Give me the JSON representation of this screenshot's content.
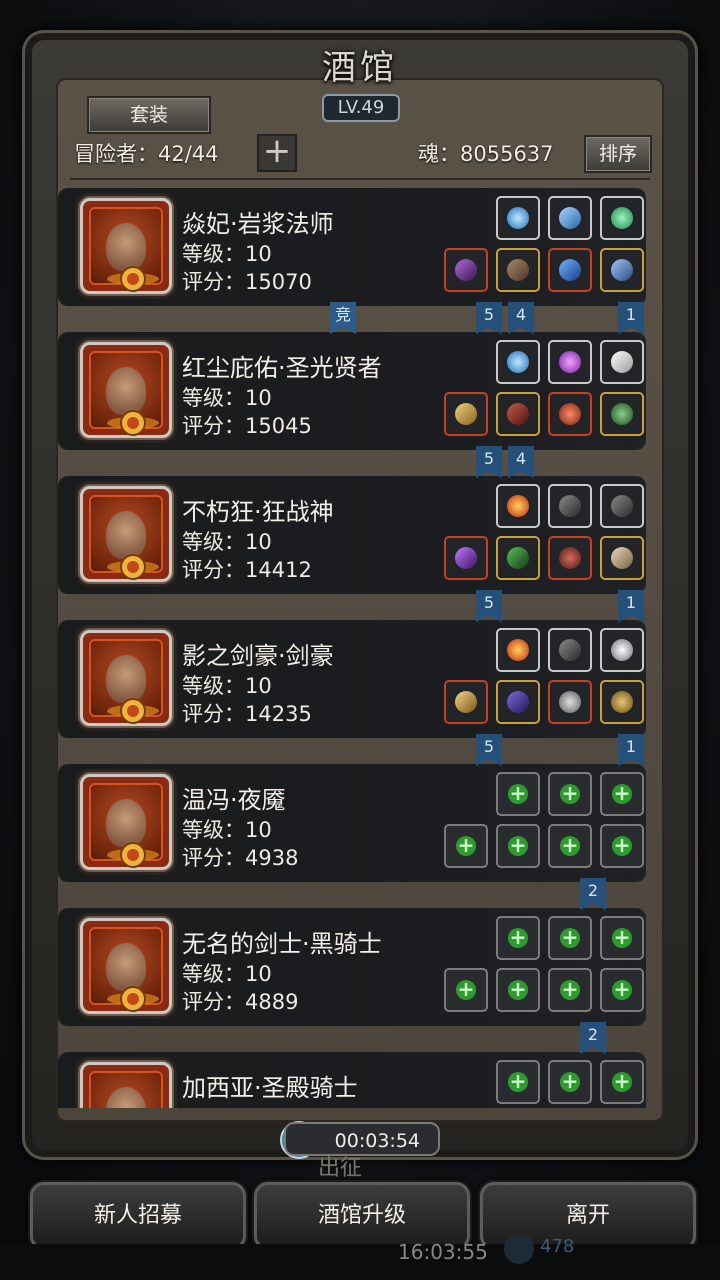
{
  "window": {
    "title": "酒馆",
    "level": "LV.49"
  },
  "header": {
    "suit_button": "套装",
    "adventurers_label": "冒险者：42/44",
    "add_icon": "plus-icon",
    "soul_label": "魂：8055637",
    "sort_button": "排序"
  },
  "heroes": [
    {
      "name": "焱妃·岩浆法师",
      "level": "等级：10",
      "score": "评分：15070",
      "portrait_icon": "hooded-mage-portrait",
      "top_slots": [
        "blue-orb-icon",
        "blue-crystal-icon",
        "green-gem-icon"
      ],
      "bottom_slots": [
        "purple-staff-icon",
        "leather-armor-icon",
        "blue-blade-icon",
        "blue-sword-icon"
      ]
    },
    {
      "name": "红尘庇佑·圣光贤者",
      "level": "等级：10",
      "score": "评分：15045",
      "portrait_icon": "priestess-portrait",
      "top_slots": [
        "blue-orb-icon",
        "purple-gem-icon",
        "white-wing-icon"
      ],
      "bottom_slots": [
        "golden-hammer-icon",
        "red-robe-icon",
        "red-amulet-icon",
        "green-necklace-icon"
      ]
    },
    {
      "name": "不朽狂·狂战神",
      "level": "等级：10",
      "score": "评分：14412",
      "portrait_icon": "berserker-portrait",
      "top_slots": [
        "fire-rune-icon",
        "dark-claw-icon",
        "dark-claw-icon"
      ],
      "bottom_slots": [
        "purple-axe-icon",
        "green-armor-icon",
        "red-helmet-icon",
        "bone-arm-icon"
      ]
    },
    {
      "name": "影之剑豪·剑豪",
      "level": "等级：10",
      "score": "评分：14235",
      "portrait_icon": "swordsman-portrait",
      "top_slots": [
        "fire-rune-icon",
        "dark-claw-icon",
        "silver-rune-icon"
      ],
      "bottom_slots": [
        "golden-sword-icon",
        "purple-armor-icon",
        "silver-ring-icon",
        "gold-ring-icon"
      ]
    },
    {
      "name": "温冯·夜魇",
      "level": "等级：10",
      "score": "评分：4938",
      "portrait_icon": "eyepatch-portrait",
      "top_slots": [
        "empty",
        "empty",
        "empty"
      ],
      "bottom_slots": [
        "empty",
        "empty",
        "empty",
        "empty"
      ]
    },
    {
      "name": "无名的剑士·黑骑士",
      "level": "等级：10",
      "score": "评分：4889",
      "portrait_icon": "dark-knight-portrait",
      "top_slots": [
        "empty",
        "empty",
        "empty"
      ],
      "bottom_slots": [
        "empty",
        "empty",
        "empty",
        "empty"
      ]
    },
    {
      "name": "加西亚·圣殿骑士",
      "level": "",
      "score": "",
      "portrait_icon": "templar-portrait",
      "top_slots": [
        "empty",
        "empty",
        "empty"
      ],
      "bottom_slots": []
    }
  ],
  "ribbons": [
    {
      "label": "竞"
    },
    {
      "label": "5"
    },
    {
      "label": "4"
    },
    {
      "label": "1"
    },
    {
      "label": "5"
    },
    {
      "label": "4"
    },
    {
      "label": "5"
    },
    {
      "label": "1"
    },
    {
      "label": "5"
    },
    {
      "label": "1"
    },
    {
      "label": "2"
    },
    {
      "label": "2"
    }
  ],
  "timer": "00:03:54",
  "faded_label": "出征",
  "buttons": {
    "recruit": "新人招募",
    "upgrade": "酒馆升级",
    "leave": "离开"
  },
  "status_bar": {
    "clock": "16:03:55",
    "soul_count": "478"
  },
  "colors": {
    "panel": "#524a40",
    "card": "#1c1d20",
    "ribbon": "#25507a",
    "empty_plus": "#2e9b2e"
  }
}
